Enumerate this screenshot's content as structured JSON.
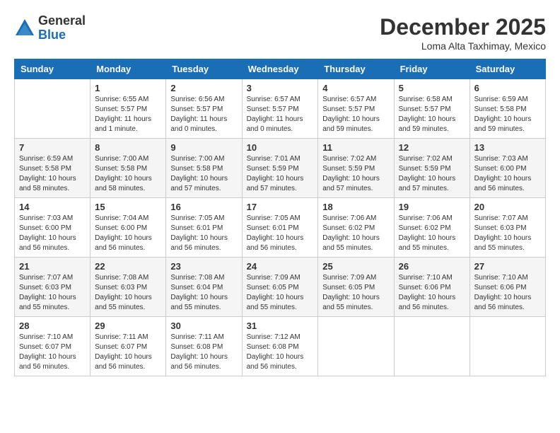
{
  "logo": {
    "general": "General",
    "blue": "Blue"
  },
  "title": {
    "month": "December 2025",
    "location": "Loma Alta Taxhimay, Mexico"
  },
  "weekdays": [
    "Sunday",
    "Monday",
    "Tuesday",
    "Wednesday",
    "Thursday",
    "Friday",
    "Saturday"
  ],
  "weeks": [
    [
      {
        "day": "",
        "info": ""
      },
      {
        "day": "1",
        "info": "Sunrise: 6:55 AM\nSunset: 5:57 PM\nDaylight: 11 hours\nand 1 minute."
      },
      {
        "day": "2",
        "info": "Sunrise: 6:56 AM\nSunset: 5:57 PM\nDaylight: 11 hours\nand 0 minutes."
      },
      {
        "day": "3",
        "info": "Sunrise: 6:57 AM\nSunset: 5:57 PM\nDaylight: 11 hours\nand 0 minutes."
      },
      {
        "day": "4",
        "info": "Sunrise: 6:57 AM\nSunset: 5:57 PM\nDaylight: 10 hours\nand 59 minutes."
      },
      {
        "day": "5",
        "info": "Sunrise: 6:58 AM\nSunset: 5:57 PM\nDaylight: 10 hours\nand 59 minutes."
      },
      {
        "day": "6",
        "info": "Sunrise: 6:59 AM\nSunset: 5:58 PM\nDaylight: 10 hours\nand 59 minutes."
      }
    ],
    [
      {
        "day": "7",
        "info": "Sunrise: 6:59 AM\nSunset: 5:58 PM\nDaylight: 10 hours\nand 58 minutes."
      },
      {
        "day": "8",
        "info": "Sunrise: 7:00 AM\nSunset: 5:58 PM\nDaylight: 10 hours\nand 58 minutes."
      },
      {
        "day": "9",
        "info": "Sunrise: 7:00 AM\nSunset: 5:58 PM\nDaylight: 10 hours\nand 57 minutes."
      },
      {
        "day": "10",
        "info": "Sunrise: 7:01 AM\nSunset: 5:59 PM\nDaylight: 10 hours\nand 57 minutes."
      },
      {
        "day": "11",
        "info": "Sunrise: 7:02 AM\nSunset: 5:59 PM\nDaylight: 10 hours\nand 57 minutes."
      },
      {
        "day": "12",
        "info": "Sunrise: 7:02 AM\nSunset: 5:59 PM\nDaylight: 10 hours\nand 57 minutes."
      },
      {
        "day": "13",
        "info": "Sunrise: 7:03 AM\nSunset: 6:00 PM\nDaylight: 10 hours\nand 56 minutes."
      }
    ],
    [
      {
        "day": "14",
        "info": "Sunrise: 7:03 AM\nSunset: 6:00 PM\nDaylight: 10 hours\nand 56 minutes."
      },
      {
        "day": "15",
        "info": "Sunrise: 7:04 AM\nSunset: 6:00 PM\nDaylight: 10 hours\nand 56 minutes."
      },
      {
        "day": "16",
        "info": "Sunrise: 7:05 AM\nSunset: 6:01 PM\nDaylight: 10 hours\nand 56 minutes."
      },
      {
        "day": "17",
        "info": "Sunrise: 7:05 AM\nSunset: 6:01 PM\nDaylight: 10 hours\nand 56 minutes."
      },
      {
        "day": "18",
        "info": "Sunrise: 7:06 AM\nSunset: 6:02 PM\nDaylight: 10 hours\nand 55 minutes."
      },
      {
        "day": "19",
        "info": "Sunrise: 7:06 AM\nSunset: 6:02 PM\nDaylight: 10 hours\nand 55 minutes."
      },
      {
        "day": "20",
        "info": "Sunrise: 7:07 AM\nSunset: 6:03 PM\nDaylight: 10 hours\nand 55 minutes."
      }
    ],
    [
      {
        "day": "21",
        "info": "Sunrise: 7:07 AM\nSunset: 6:03 PM\nDaylight: 10 hours\nand 55 minutes."
      },
      {
        "day": "22",
        "info": "Sunrise: 7:08 AM\nSunset: 6:03 PM\nDaylight: 10 hours\nand 55 minutes."
      },
      {
        "day": "23",
        "info": "Sunrise: 7:08 AM\nSunset: 6:04 PM\nDaylight: 10 hours\nand 55 minutes."
      },
      {
        "day": "24",
        "info": "Sunrise: 7:09 AM\nSunset: 6:05 PM\nDaylight: 10 hours\nand 55 minutes."
      },
      {
        "day": "25",
        "info": "Sunrise: 7:09 AM\nSunset: 6:05 PM\nDaylight: 10 hours\nand 55 minutes."
      },
      {
        "day": "26",
        "info": "Sunrise: 7:10 AM\nSunset: 6:06 PM\nDaylight: 10 hours\nand 56 minutes."
      },
      {
        "day": "27",
        "info": "Sunrise: 7:10 AM\nSunset: 6:06 PM\nDaylight: 10 hours\nand 56 minutes."
      }
    ],
    [
      {
        "day": "28",
        "info": "Sunrise: 7:10 AM\nSunset: 6:07 PM\nDaylight: 10 hours\nand 56 minutes."
      },
      {
        "day": "29",
        "info": "Sunrise: 7:11 AM\nSunset: 6:07 PM\nDaylight: 10 hours\nand 56 minutes."
      },
      {
        "day": "30",
        "info": "Sunrise: 7:11 AM\nSunset: 6:08 PM\nDaylight: 10 hours\nand 56 minutes."
      },
      {
        "day": "31",
        "info": "Sunrise: 7:12 AM\nSunset: 6:08 PM\nDaylight: 10 hours\nand 56 minutes."
      },
      {
        "day": "",
        "info": ""
      },
      {
        "day": "",
        "info": ""
      },
      {
        "day": "",
        "info": ""
      }
    ]
  ]
}
